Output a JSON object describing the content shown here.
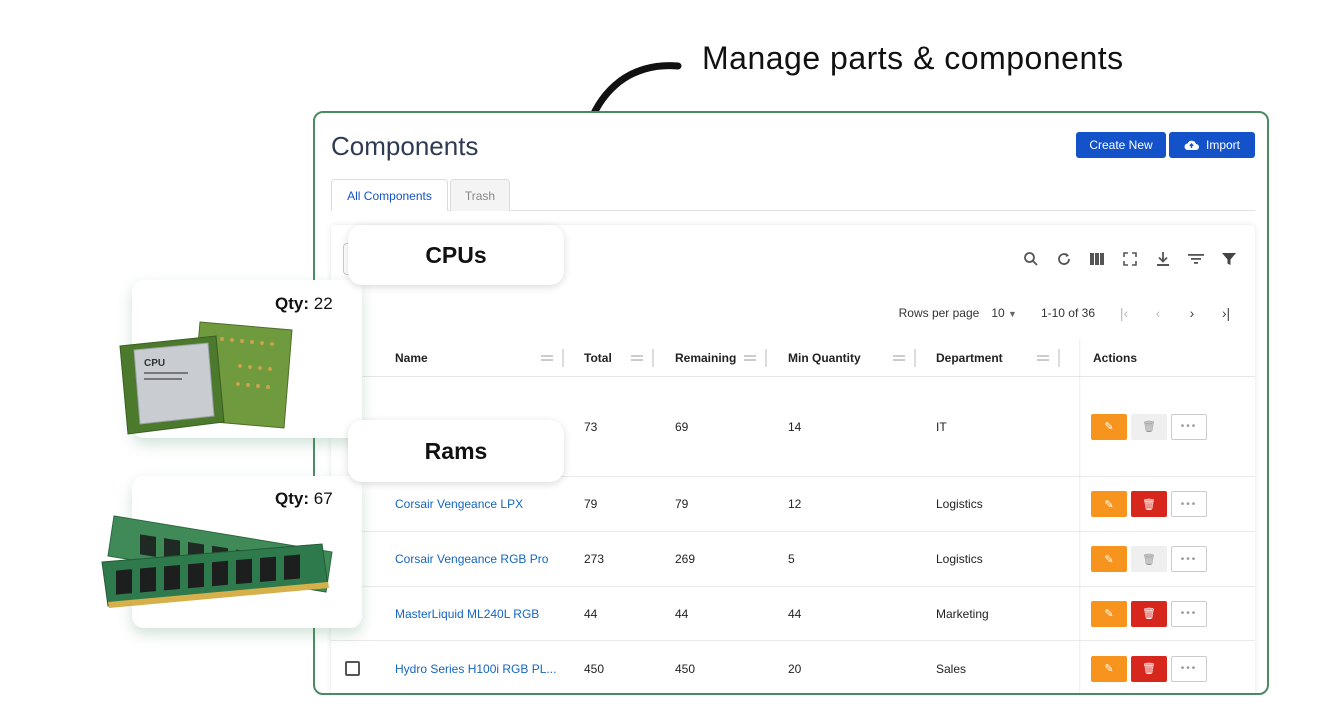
{
  "headline": "Manage parts & components",
  "page": {
    "title": "Components",
    "create_label": "Create New",
    "import_label": "Import",
    "tabs": [
      {
        "label": "All Components",
        "active": true
      },
      {
        "label": "Trash",
        "active": false
      }
    ]
  },
  "toolbar_icons": [
    "search-icon",
    "refresh-icon",
    "columns-icon",
    "fullscreen-icon",
    "download-icon",
    "density-icon",
    "filter-icon"
  ],
  "pagination": {
    "rows_label": "Rows per page",
    "rows_value": "10",
    "range": "1-10 of 36"
  },
  "table": {
    "headers": [
      "Name",
      "Total",
      "Remaining",
      "Min Quantity",
      "Department",
      "Actions"
    ],
    "rows": [
      {
        "name": "",
        "total": "73",
        "remaining": "69",
        "min_qty": "14",
        "department": "IT",
        "delete_enabled": false
      },
      {
        "name": "Corsair Vengeance LPX",
        "total": "79",
        "remaining": "79",
        "min_qty": "12",
        "department": "Logistics",
        "delete_enabled": true
      },
      {
        "name": "Corsair Vengeance RGB Pro",
        "total": "273",
        "remaining": "269",
        "min_qty": "5",
        "department": "Logistics",
        "delete_enabled": false
      },
      {
        "name": "MasterLiquid ML240L RGB",
        "total": "44",
        "remaining": "44",
        "min_qty": "44",
        "department": "Marketing",
        "delete_enabled": true
      },
      {
        "name": "Hydro Series H100i RGB PL...",
        "total": "450",
        "remaining": "450",
        "min_qty": "20",
        "department": "Sales",
        "delete_enabled": true
      }
    ]
  },
  "callouts": [
    {
      "label": "CPUs",
      "qty_label": "Qty:",
      "qty_value": "22",
      "image": "cpu-chip"
    },
    {
      "label": "Rams",
      "qty_label": "Qty:",
      "qty_value": "67",
      "image": "ram-sticks"
    }
  ],
  "colors": {
    "primary": "#1352c9",
    "edit": "#f7941d",
    "delete": "#d7261b",
    "frame": "#4a8c62",
    "link": "#1565c0"
  }
}
